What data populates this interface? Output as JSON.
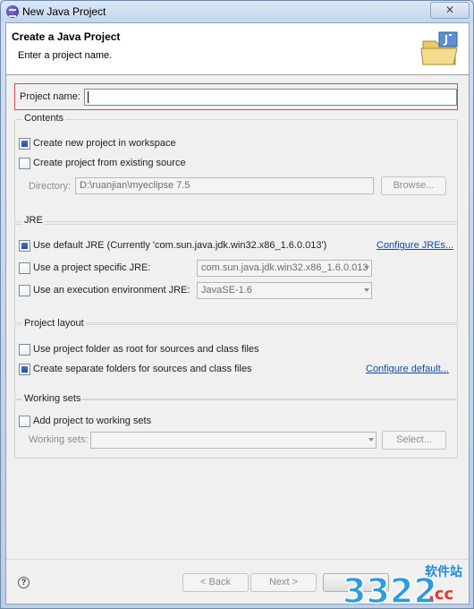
{
  "window": {
    "title": "New Java Project",
    "close_symbol": "✕"
  },
  "header": {
    "title": "Create a Java Project",
    "message": "Enter a project name."
  },
  "project_name": {
    "label": "Project name:",
    "value": ""
  },
  "contents": {
    "title": "Contents",
    "create_new": {
      "label": "Create new project in workspace",
      "checked": true
    },
    "from_existing": {
      "label": "Create project from existing source",
      "checked": false
    },
    "directory_label": "Directory:",
    "directory_value": "D:\\ruanjian\\myeclipse 7.5",
    "browse_label": "Browse..."
  },
  "jre": {
    "title": "JRE",
    "use_default": {
      "label": "Use default JRE (Currently 'com.sun.java.jdk.win32.x86_1.6.0.013')",
      "checked": true
    },
    "configure_link": "Configure JREs...",
    "project_specific": {
      "label": "Use a project specific JRE:",
      "checked": false,
      "value": "com.sun.java.jdk.win32.x86_1.6.0.013"
    },
    "execution_env": {
      "label": "Use an execution environment JRE:",
      "checked": false,
      "value": "JavaSE-1.6"
    }
  },
  "project_layout": {
    "title": "Project layout",
    "root_folder": {
      "label": "Use project folder as root for sources and class files",
      "checked": false
    },
    "separate_folders": {
      "label": "Create separate folders for sources and class files",
      "checked": true
    },
    "configure_link": "Configure default..."
  },
  "working_sets": {
    "title": "Working sets",
    "add_to": {
      "label": "Add project to working sets",
      "checked": false
    },
    "label": "Working sets:",
    "value": "",
    "select_label": "Select..."
  },
  "footer": {
    "help_symbol": "?",
    "back_label": "< Back",
    "next_label": "Next >"
  },
  "watermark": {
    "number": "3322",
    "cn_text": "软件站",
    "domain": ".cc"
  },
  "colors": {
    "accent": "#0b4ba6",
    "highlight_border": "#d94a4a",
    "checkbox_fill": "#2a4e99"
  },
  "icons": {
    "app": "eclipse-icon",
    "banner": "java-project-folder-icon",
    "help": "help-icon"
  }
}
